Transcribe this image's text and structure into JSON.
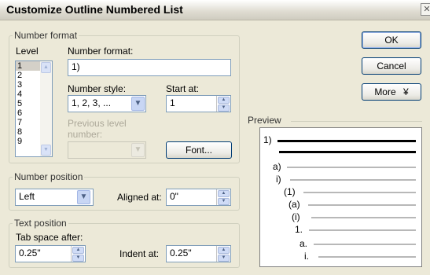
{
  "dialog": {
    "title": "Customize Outline Numbered List",
    "close_glyph": "✕"
  },
  "number_format": {
    "group": "Number format",
    "level_label": "Level",
    "levels": [
      "1",
      "2",
      "3",
      "4",
      "5",
      "6",
      "7",
      "8",
      "9"
    ],
    "selected_level": "1",
    "number_format_label": "Number format:",
    "number_format_value": "1)",
    "number_style_label": "Number style:",
    "number_style_value": "1, 2, 3, ...",
    "start_at_label": "Start at:",
    "start_at_value": "1",
    "previous_level_label": "Previous level number:",
    "font_button": "Font..."
  },
  "number_position": {
    "group": "Number position",
    "alignment_value": "Left",
    "aligned_at_label": "Aligned at:",
    "aligned_at_value": "0\""
  },
  "text_position": {
    "group": "Text position",
    "tab_space_label": "Tab space after:",
    "tab_space_value": "0.25\"",
    "indent_at_label": "Indent at:",
    "indent_at_value": "0.25\""
  },
  "buttons": {
    "ok": "OK",
    "cancel": "Cancel",
    "more": "More",
    "more_glyph": "¥"
  },
  "preview": {
    "label": "Preview",
    "rows": [
      "1)",
      "",
      "a)",
      "i)",
      "(1)",
      "(a)",
      "(i)",
      "1.",
      "a.",
      "i."
    ]
  },
  "icons": {
    "spin_up": "▲",
    "spin_down": "▼",
    "dropdown": "▼",
    "scroll_up": "▲",
    "scroll_down": "▼"
  }
}
